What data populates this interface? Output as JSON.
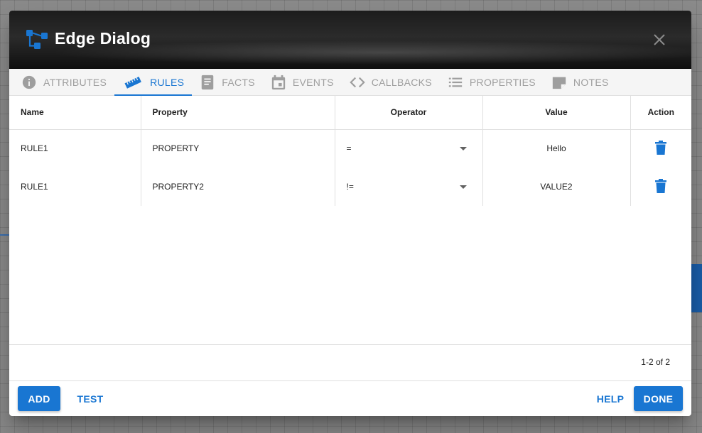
{
  "dialog": {
    "title": "Edge Dialog"
  },
  "tabs": [
    {
      "label": "ATTRIBUTES",
      "icon": "info-icon"
    },
    {
      "label": "RULES",
      "icon": "ruler-icon",
      "active": true
    },
    {
      "label": "FACTS",
      "icon": "book-icon"
    },
    {
      "label": "EVENTS",
      "icon": "calendar-icon"
    },
    {
      "label": "CALLBACKS",
      "icon": "code-icon"
    },
    {
      "label": "PROPERTIES",
      "icon": "list-icon"
    },
    {
      "label": "NOTES",
      "icon": "note-icon"
    }
  ],
  "table": {
    "headers": {
      "name": "Name",
      "property": "Property",
      "operator": "Operator",
      "value": "Value",
      "action": "Action"
    },
    "rows": [
      {
        "name": "RULE1",
        "property": "PROPERTY",
        "operator": "=",
        "value": "Hello"
      },
      {
        "name": "RULE1",
        "property": "PROPERTY2",
        "operator": "!=",
        "value": "VALUE2"
      }
    ]
  },
  "pagination": "1-2 of 2",
  "buttons": {
    "add": "ADD",
    "test": "TEST",
    "help": "HELP",
    "done": "DONE"
  },
  "colors": {
    "accent": "#1976d2",
    "header_bg": "#1c1c1c"
  }
}
